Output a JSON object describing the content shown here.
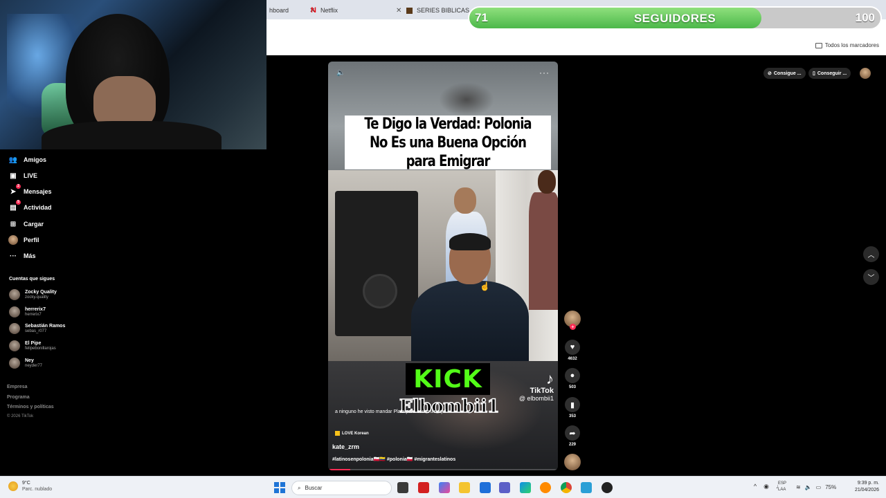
{
  "browser": {
    "tabs": [
      {
        "label": "hboard"
      },
      {
        "label": "Netflix"
      },
      {
        "label": "SERIES BIBLICAS .NET"
      }
    ],
    "bookmarks_all": "Todos los marcadores"
  },
  "followers_bar": {
    "current": "71",
    "label": "SEGUIDORES",
    "goal": "100",
    "progress": 0.71,
    "fill_color": "#5cc655"
  },
  "sidebar": {
    "nav": [
      {
        "label": "Amigos",
        "icon": "users-icon"
      },
      {
        "label": "LIVE",
        "icon": "live-icon"
      },
      {
        "label": "Mensajes",
        "icon": "send-icon",
        "badge": "2"
      },
      {
        "label": "Actividad",
        "icon": "activity-icon",
        "badge": "5"
      },
      {
        "label": "Cargar",
        "icon": "plus-square-icon"
      },
      {
        "label": "Perfil",
        "icon": "avatar"
      },
      {
        "label": "Más",
        "icon": "more-icon"
      }
    ],
    "following_title": "Cuentas que sigues",
    "following": [
      {
        "name": "Zocky Quality",
        "user": "zocky.quality"
      },
      {
        "name": "herrerix7",
        "user": "herrerix7"
      },
      {
        "name": "Sebastián Ramos",
        "user": "sebas_r077"
      },
      {
        "name": "El Pipe",
        "user": "felipebonillarojas"
      },
      {
        "name": "Ney",
        "user": "neyder77"
      }
    ],
    "footer": [
      "Empresa",
      "Programa",
      "Términos y políticas"
    ],
    "copyright": "© 2026 TikTok"
  },
  "video": {
    "title": "Te Digo la Verdad: Polonia No Es una Buena Opción para Emigrar",
    "overlay_kick": "KICK",
    "overlay_name": "Elbombii1",
    "watermark_brand": "TikTok",
    "watermark_handle": "@ elbombii1",
    "caption": "a ninguno he visto mandar Plata para construir aquí",
    "music": "LOVE Korean",
    "username": "kate_zrm",
    "hashtags": "#latinosenpolonia🇵🇱🇨🇴 #polonia🇵🇱 #migranteslatinos"
  },
  "actions": {
    "likes": "4632",
    "comments": "503",
    "saves": "353",
    "shares": "229"
  },
  "top_right": {
    "pill1": "Consigue ...",
    "pill2": "Conseguir ..."
  },
  "taskbar": {
    "weather_temp": "9°C",
    "weather_desc": "Parc. nublado",
    "search_placeholder": "Buscar",
    "lang1": "ESP",
    "lang2": "LAA",
    "battery": "75%",
    "time": "9:39 p. m.",
    "date": "21/04/2026"
  }
}
